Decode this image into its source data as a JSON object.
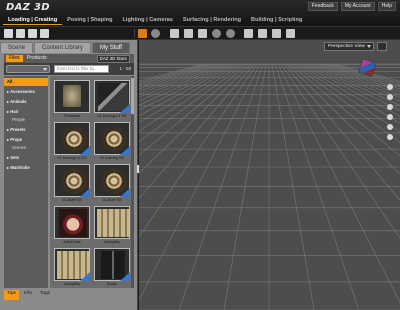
{
  "app": {
    "logo_text": "DAZ 3D",
    "top_links": [
      "Feedback",
      "My Account",
      "Help"
    ],
    "nav": [
      "Loading | Creating",
      "Posing | Shaping",
      "Lighting | Cameras",
      "Surfacing | Rendering",
      "Building | Scripting"
    ],
    "active_nav": "Loading | Creating"
  },
  "toolbar": {
    "icons": [
      "new-file-icon",
      "open-file-icon",
      "save-file-icon",
      "document-icon",
      "node-select-icon",
      "rotate-icon",
      "universal-tool-icon",
      "move-tool-icon",
      "scale-tool-icon",
      "joint-editor-icon",
      "surface-selection-icon",
      "region-nav-icon",
      "spot-render-icon",
      "render-icon",
      "figure-icon"
    ]
  },
  "left_panel": {
    "tabs": [
      "Scene",
      "Content Library",
      "My Stuff"
    ],
    "active_tab": "My Stuff",
    "subtabs": [
      "Files",
      "Products"
    ],
    "active_subtab": "Files",
    "store_button": "DAZ 3D Store",
    "filter_placeholder": "Enter text to filter by...",
    "result_count": "1 - 58",
    "categories": [
      {
        "label": "All",
        "level": "top",
        "active": true
      },
      {
        "label": "▸ Accessories",
        "level": "top"
      },
      {
        "label": "▸ Animals",
        "level": "top"
      },
      {
        "label": "▸ Hair",
        "level": "top"
      },
      {
        "label": "People",
        "level": "sub"
      },
      {
        "label": "▸ Presets",
        "level": "top"
      },
      {
        "label": "▸ Props",
        "level": "top"
      },
      {
        "label": "Scenes",
        "level": "sub"
      },
      {
        "label": "▸ Sets",
        "level": "top"
      },
      {
        "label": "▸ Wardrobe",
        "level": "top"
      }
    ],
    "thumbnails": [
      {
        "label": "!Pedestal",
        "style": "plain"
      },
      {
        "label": "01-Earring L1 SS",
        "style": "earring2"
      },
      {
        "label": "01-Earring L2 DS",
        "style": "earring"
      },
      {
        "label": "01-Earring SS",
        "style": "earring"
      },
      {
        "label": "01-Staff DS",
        "style": "earring"
      },
      {
        "label": "01-Staff SS",
        "style": "earring"
      },
      {
        "label": "Adiva Hair",
        "style": "face"
      },
      {
        "label": "Archpillar",
        "style": "pillar"
      },
      {
        "label": "Archpillar",
        "style": "pillar"
      },
      {
        "label": "Boots",
        "style": "boots"
      }
    ],
    "bottom_tabs": [
      "Tips",
      "Info",
      "Tags"
    ],
    "active_bottom_tab": "Tips"
  },
  "viewport": {
    "camera": "Perspective View",
    "bg_color": "#4d4d4d"
  }
}
